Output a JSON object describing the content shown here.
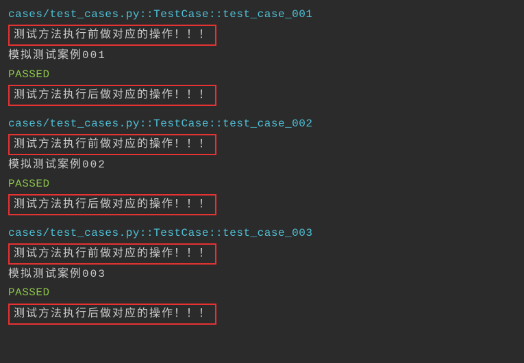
{
  "tests": [
    {
      "path": "cases/test_cases.py::TestCase::test_case_001",
      "setup": "测试方法执行前做对应的操作！！！",
      "case": "模拟测试案例001",
      "status": "PASSED",
      "teardown": "测试方法执行后做对应的操作！！！"
    },
    {
      "path": "cases/test_cases.py::TestCase::test_case_002",
      "setup": "测试方法执行前做对应的操作！！！",
      "case": "模拟测试案例002",
      "status": "PASSED",
      "teardown": "测试方法执行后做对应的操作！！！"
    },
    {
      "path": "cases/test_cases.py::TestCase::test_case_003",
      "setup": "测试方法执行前做对应的操作！！！",
      "case": "模拟测试案例003",
      "status": "PASSED",
      "teardown": "测试方法执行后做对应的操作！！！"
    }
  ]
}
